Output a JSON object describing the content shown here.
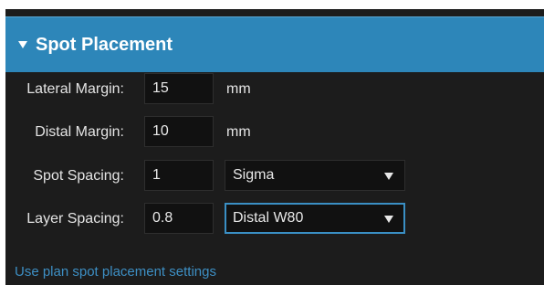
{
  "panel": {
    "title": "Spot Placement"
  },
  "rows": [
    {
      "label": "Lateral Margin:",
      "value": "15",
      "unit": "mm"
    },
    {
      "label": "Distal Margin:",
      "value": "10",
      "unit": "mm"
    },
    {
      "label": "Spot Spacing:",
      "value": "1",
      "select": "Sigma"
    },
    {
      "label": "Layer Spacing:",
      "value": "0.8",
      "select": "Distal W80"
    }
  ],
  "link": {
    "label": "Use plan spot placement settings"
  },
  "colors": {
    "header": "#2d86b9",
    "panel_bg": "#1c1c1c",
    "field_bg": "#111111",
    "link": "#3d8fc4",
    "focus_border": "#3a8fc4"
  },
  "icons": {
    "collapse": "triangle-down-icon",
    "dropdown": "caret-down-icon"
  }
}
